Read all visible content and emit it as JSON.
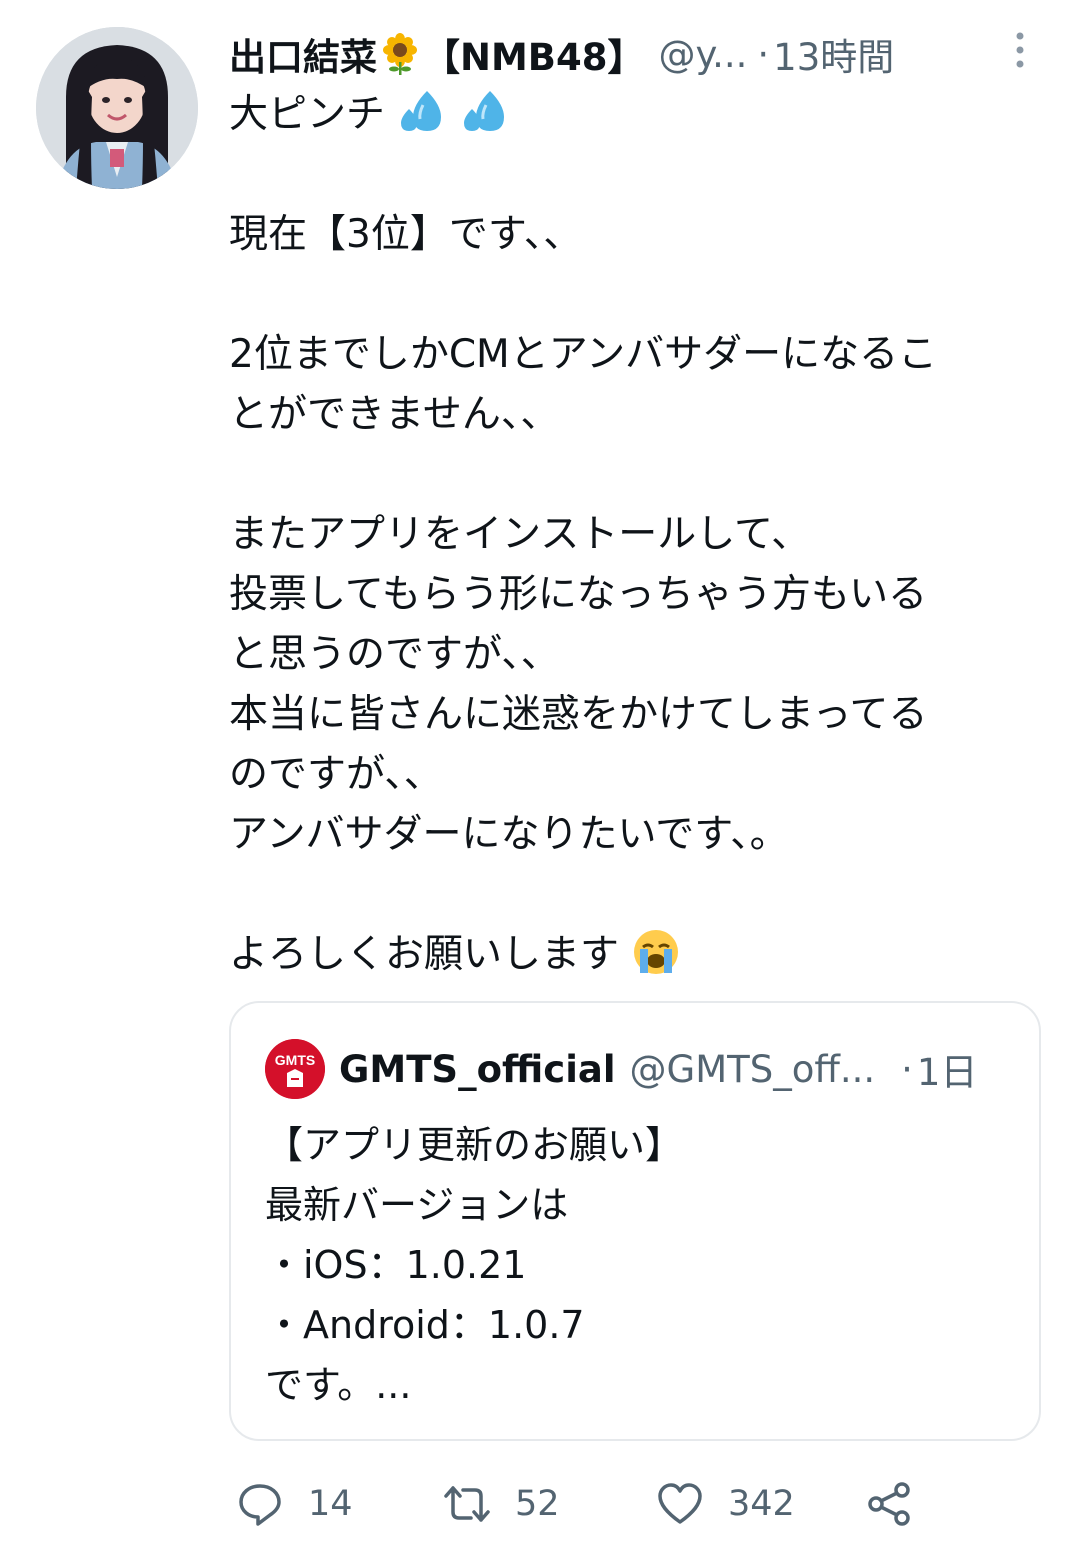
{
  "tweet": {
    "display_name": "出口結菜",
    "name_emoji": "sunflower-emoji",
    "name_suffix": "【NMB48】",
    "handle": "@y...",
    "dot": "·",
    "time": "13時間",
    "lines": [
      "大ピンチ",
      "",
      "現在【3位】です、、",
      "",
      "2位までしかCMとアンバサダーになるこ",
      "とができません、、",
      "",
      "またアプリをインストールして、",
      "投票してもらう形になっちゃう方もいる",
      "と思うのですが、、",
      "本当に皆さんに迷惑をかけてしまってる",
      "のですが、、",
      "アンバサダーになりたいです、。",
      "",
      "よろしくお願いします"
    ],
    "emojis": [
      "sweat-droplets-emoji",
      "sweat-droplets-emoji",
      "loudly-crying-face-emoji"
    ]
  },
  "quote": {
    "avatar_text": "GMTS",
    "name": "GMTS_official",
    "handle": "@GMTS_off...",
    "dot": "·",
    "time": "1日",
    "lines": [
      "【アプリ更新のお願い】",
      "最新バージョンは",
      "・iOS：1.0.21",
      "・Android：1.0.7",
      "です。..."
    ]
  },
  "actions": {
    "reply_count": "14",
    "retweet_count": "52",
    "like_count": "342",
    "icons": [
      "reply-icon",
      "retweet-icon",
      "like-icon",
      "share-icon"
    ]
  },
  "colors": {
    "text": "#0f1419",
    "secondary": "#536471",
    "border": "#e6e9ec",
    "gmts_red": "#d4102a"
  }
}
